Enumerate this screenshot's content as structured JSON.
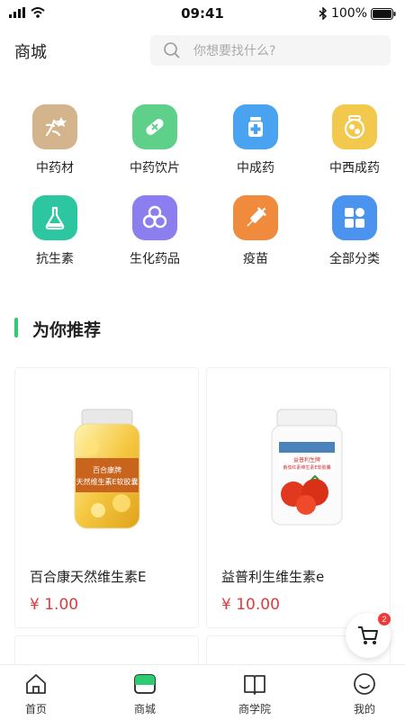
{
  "status_bar": {
    "time": "09:41",
    "battery": "100%"
  },
  "header": {
    "title": "商城",
    "search": {
      "placeholder": "你想要找什么?"
    }
  },
  "categories": [
    {
      "label": "中药材",
      "icon": "herb-root-icon",
      "color": "#d4b48c"
    },
    {
      "label": "中药饮片",
      "icon": "capsule-icon",
      "color": "#5fd08a"
    },
    {
      "label": "中成药",
      "icon": "medicine-bottle-icon",
      "color": "#4aa3f0"
    },
    {
      "label": "中西成药",
      "icon": "pill-jar-icon",
      "color": "#f2c94c"
    },
    {
      "label": "抗生素",
      "icon": "flask-icon",
      "color": "#2cc6a0"
    },
    {
      "label": "生化药品",
      "icon": "biohazard-icon",
      "color": "#8b7ff0"
    },
    {
      "label": "疫苗",
      "icon": "syringe-icon",
      "color": "#f08a3c"
    },
    {
      "label": "全部分类",
      "icon": "grid-icon",
      "color": "#4a94f0"
    }
  ],
  "section": {
    "title": "为你推荐"
  },
  "products": [
    {
      "name": "百合康天然维生素E",
      "price": "¥ 1.00",
      "jar_label": "百合康牌 天然维生素E软胶囊"
    },
    {
      "name": "益普利生维生素e",
      "price": "¥ 10.00",
      "jar_label": "益普利生牌 番茄红素维生素E软胶囊"
    }
  ],
  "cart": {
    "count": "2"
  },
  "tabbar": [
    {
      "label": "首页",
      "icon": "home-icon"
    },
    {
      "label": "商城",
      "icon": "store-icon",
      "active": true
    },
    {
      "label": "商学院",
      "icon": "book-icon"
    },
    {
      "label": "我的",
      "icon": "profile-icon"
    }
  ],
  "colors": {
    "accent": "#2ecc71",
    "price": "#e03a3a"
  }
}
